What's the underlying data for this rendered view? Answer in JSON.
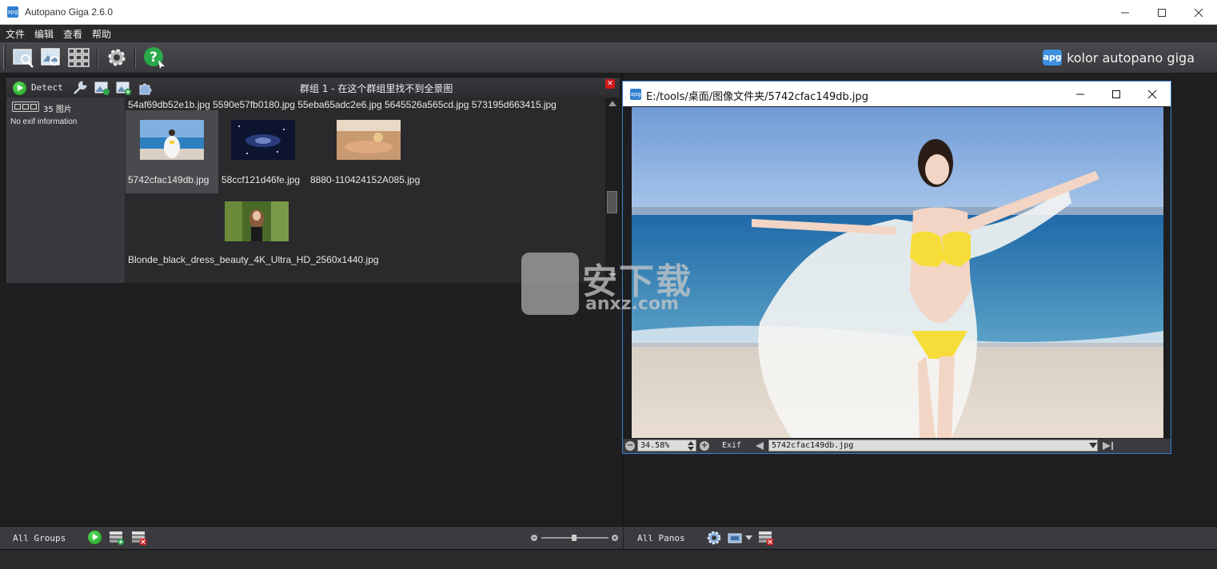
{
  "window": {
    "title": "Autopano Giga 2.6.0",
    "icon_text": "apg"
  },
  "menu": [
    "文件",
    "编辑",
    "查看",
    "帮助"
  ],
  "toolbar": {
    "brand_logo": "apg",
    "brand_text": "kolor autopano giga"
  },
  "group": {
    "detect_label": "Detect",
    "title": "群组 1 - 在这个群组里找不到全景图",
    "image_count": "35 图片",
    "exif": "No exif information",
    "top_filenames": "54af69db52e1b.jpg  5590e57fb0180.jpg  55eba65adc2e6.jpg  5645526a565cd.jpg  573195d663415.jpg",
    "thumbnails": [
      {
        "name": "5742cfac149db.jpg",
        "selected": true
      },
      {
        "name": "58ccf121d46fe.jpg",
        "selected": false
      },
      {
        "name": "8880-110424152A085.jpg",
        "selected": false
      },
      {
        "name": "Blonde_black_dress_beauty_4K_Ultra_HD_2560x1440.jpg",
        "selected": false
      }
    ]
  },
  "left_bottom": {
    "label": "All Groups"
  },
  "right_bottom": {
    "label": "All Panos"
  },
  "viewer": {
    "title": "E:/tools/桌面/图像文件夹/5742cfac149db.jpg",
    "icon_text": "apg",
    "zoom": "34.58%",
    "exif_label": "Exif",
    "file_select": "5742cfac149db.jpg"
  },
  "watermark": {
    "big": "安下载",
    "small": "anxz.com"
  },
  "colors": {
    "background": "#1f1e21",
    "panel": "#3b3a3e",
    "accent_green": "#1c9a1c",
    "accent_blue": "#3e8fe0",
    "close_red": "#d01818"
  }
}
